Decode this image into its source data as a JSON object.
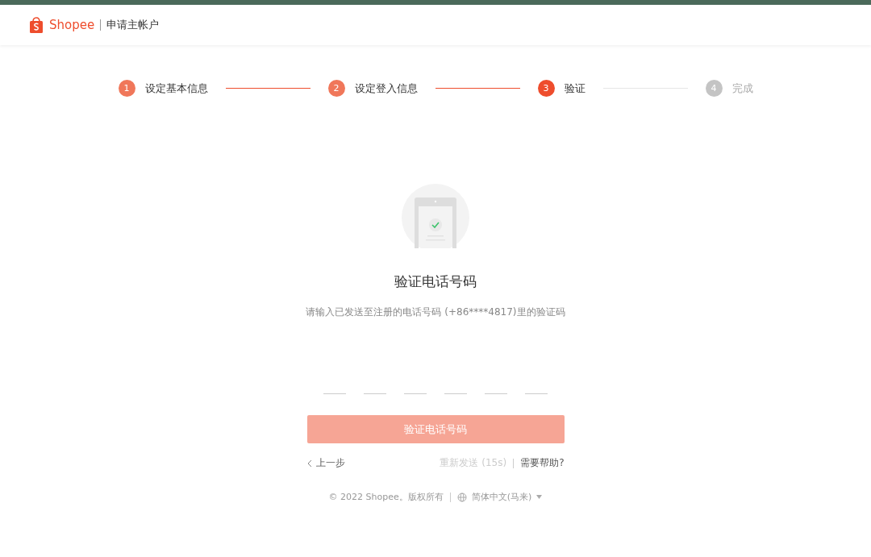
{
  "header": {
    "logo": "Shopee",
    "title": "申请主帐户"
  },
  "steps": [
    {
      "number": "1",
      "label": "设定基本信息",
      "completed": true,
      "selected": false
    },
    {
      "number": "2",
      "label": "设定登入信息",
      "completed": true,
      "selected": false
    },
    {
      "number": "3",
      "label": "验证",
      "completed": false,
      "selected": true
    },
    {
      "number": "4",
      "label": "完成",
      "completed": false,
      "selected": false
    }
  ],
  "verify": {
    "title": "验证电话号码",
    "description": "请输入已发送至注册的电话号码 (+86****4817)里的验证码",
    "button": {
      "label": "验证电话号码",
      "disabled": true
    }
  },
  "links": {
    "back": "上一步",
    "resend": {
      "label": "重新发送 (15s)",
      "disabled": true
    },
    "help": "需要帮助?"
  },
  "footer": {
    "copyright": "© 2022 Shopee。版权所有",
    "language": "简体中文(马来)"
  }
}
